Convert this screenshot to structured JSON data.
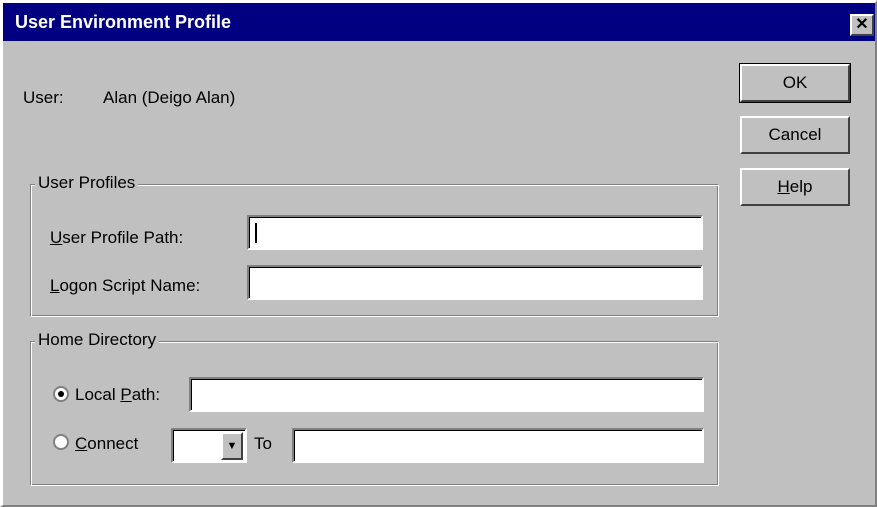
{
  "window": {
    "title": "User Environment Profile",
    "close_glyph": "✕"
  },
  "user": {
    "label": "User:",
    "value": "Alan (Deigo Alan)"
  },
  "buttons": {
    "ok": "OK",
    "cancel": "Cancel",
    "help": "Help"
  },
  "profiles": {
    "legend": "User Profiles",
    "profile_path_label": "User Profile Path:",
    "profile_path_value": "",
    "logon_script_label": "Logon Script Name:",
    "logon_script_value": ""
  },
  "home": {
    "legend": "Home Directory",
    "local_path_label": "Local Path:",
    "local_path_selected": true,
    "local_path_value": "",
    "connect_label": "Connect",
    "connect_selected": false,
    "drive_value": "",
    "to_label": "To",
    "connect_to_value": ""
  },
  "icons": {
    "close": "close-icon",
    "dropdown": "chevron-down-icon"
  }
}
